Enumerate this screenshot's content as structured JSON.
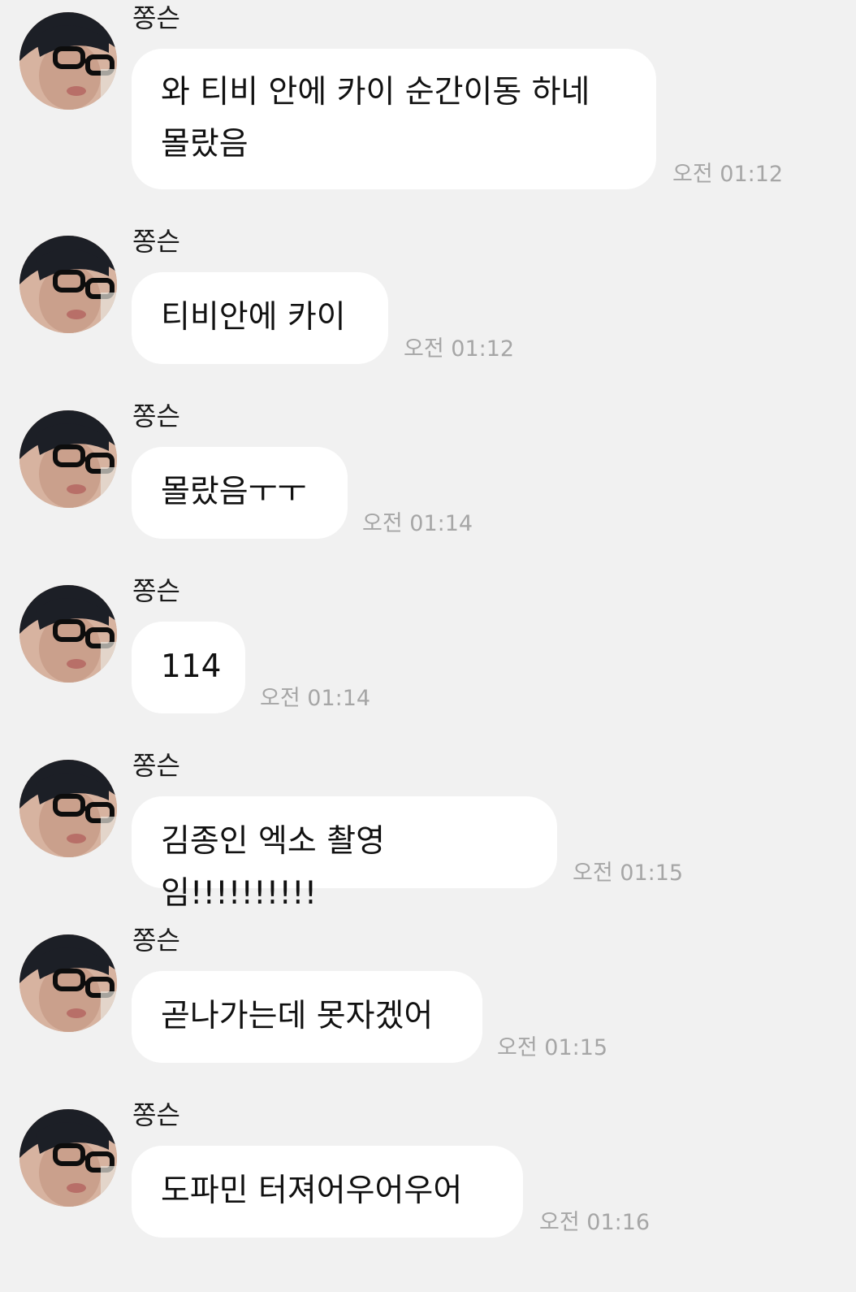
{
  "chat": {
    "messages": [
      {
        "sender": "쫑슨",
        "text": " 와 티비 안에 카이 순간이동 하네\n몰랐음",
        "time": "오전 01:12"
      },
      {
        "sender": "쫑슨",
        "text": "티비안에 카이",
        "time": "오전 01:12"
      },
      {
        "sender": "쫑슨",
        "text": "몰랐음ㅜㅜ",
        "time": "오전 01:14"
      },
      {
        "sender": "쫑슨",
        "text": "114",
        "time": "오전 01:14"
      },
      {
        "sender": "쫑슨",
        "text": "김종인 엑소 촬영임!!!!!!!!!!",
        "time": "오전 01:15"
      },
      {
        "sender": "쫑슨",
        "text": "곧나가는데 못자겠어",
        "time": "오전 01:15"
      },
      {
        "sender": "쫑슨",
        "text": " 도파민 터져어우어우어",
        "time": "오전 01:16"
      }
    ]
  }
}
